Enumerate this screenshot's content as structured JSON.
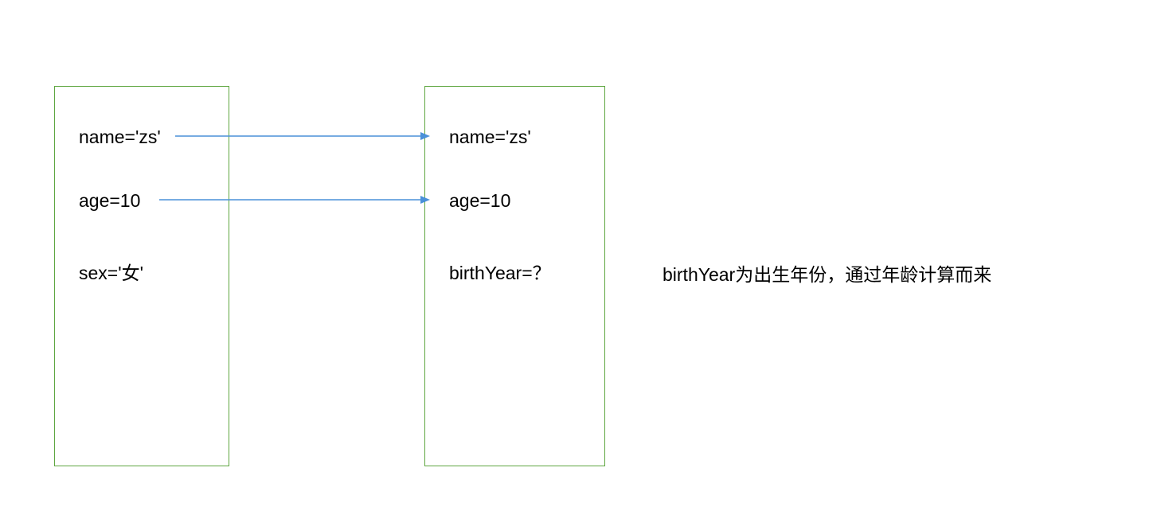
{
  "leftBox": {
    "prop1": "name='zs'",
    "prop2": "age=10",
    "prop3": "sex='女'"
  },
  "rightBox": {
    "prop1": "name='zs'",
    "prop2": "age=10",
    "prop3": "birthYear=？"
  },
  "annotation": "birthYear为出生年份，通过年龄计算而来",
  "colors": {
    "boxBorder": "#5fa641",
    "arrow": "#4a90d9"
  }
}
